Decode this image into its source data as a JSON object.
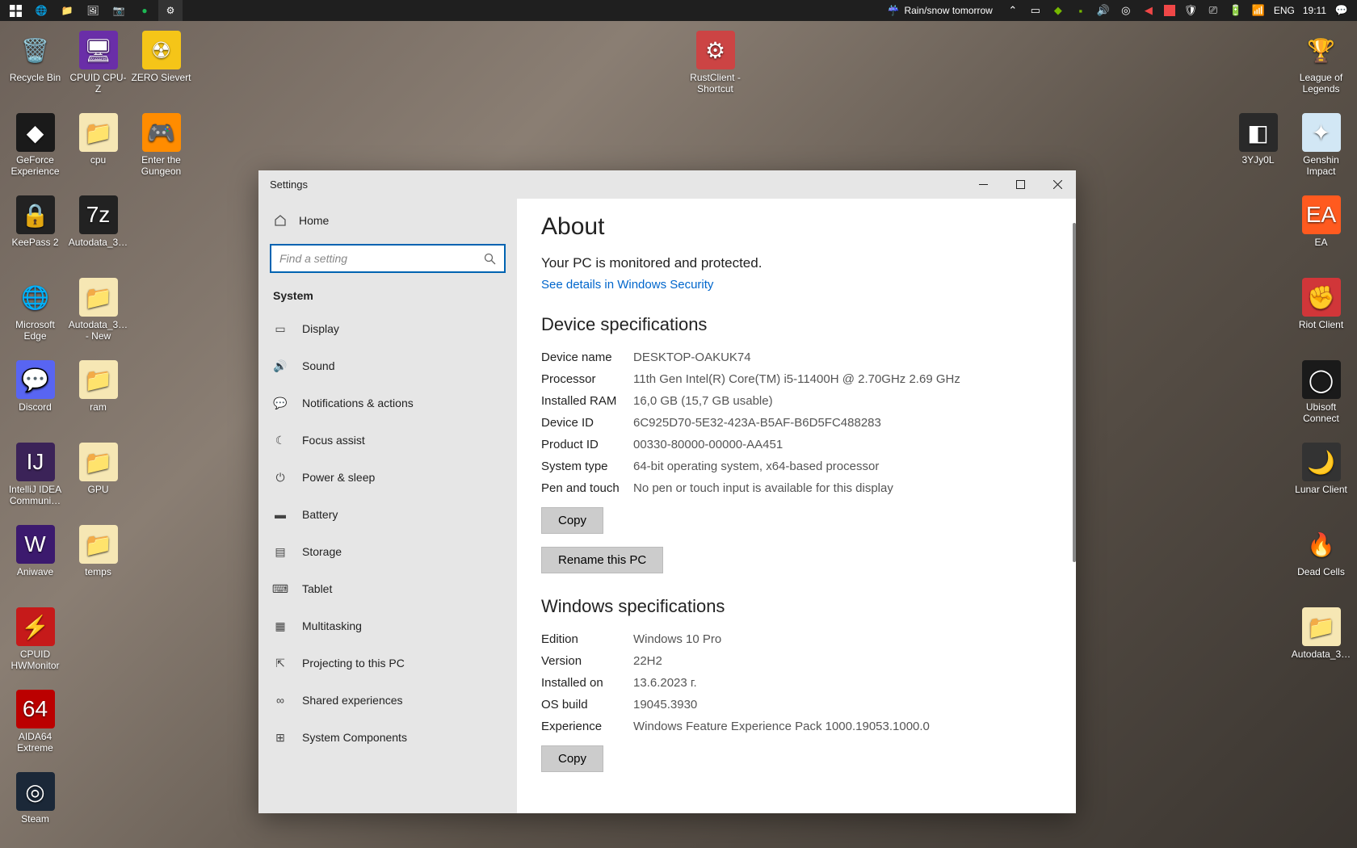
{
  "taskbar": {
    "weather_text": "Rain/snow tomorrow",
    "lang": "ENG",
    "time": "19:11"
  },
  "desktop_icons": {
    "left": [
      {
        "label": "Recycle Bin",
        "bg": "",
        "glyph": "🗑️"
      },
      {
        "label": "CPUID CPU-Z",
        "bg": "#6a2ea8",
        "glyph": "🖥"
      },
      {
        "label": "ZERO Sievert",
        "bg": "#f5c518",
        "glyph": "☢"
      },
      {
        "label": "GeForce Experience",
        "bg": "#1a1a1a",
        "glyph": "◆"
      },
      {
        "label": "cpu",
        "bg": "#f6e7b4",
        "glyph": "📁"
      },
      {
        "label": "Enter the Gungeon",
        "bg": "#ff8c00",
        "glyph": "🎮"
      },
      {
        "label": "KeePass 2",
        "bg": "#222",
        "glyph": "🔒"
      },
      {
        "label": "Autodata_3…",
        "bg": "#222",
        "glyph": "7z"
      },
      {
        "label": "Microsoft Edge",
        "bg": "",
        "glyph": "🌐"
      },
      {
        "label": "Autodata_3… - New",
        "bg": "#f6e7b4",
        "glyph": "📁"
      },
      {
        "label": "Discord",
        "bg": "#5865F2",
        "glyph": "💬"
      },
      {
        "label": "ram",
        "bg": "#f6e7b4",
        "glyph": "📁"
      },
      {
        "label": "IntelliJ IDEA Communi…",
        "bg": "#3b2358",
        "glyph": "IJ"
      },
      {
        "label": "GPU",
        "bg": "#f6e7b4",
        "glyph": "📁"
      },
      {
        "label": "Aniwave",
        "bg": "#3c1a6e",
        "glyph": "W"
      },
      {
        "label": "temps",
        "bg": "#f6e7b4",
        "glyph": "📁"
      },
      {
        "label": "CPUID HWMonitor",
        "bg": "#c61a1a",
        "glyph": "⚡"
      },
      {
        "label": "AIDA64 Extreme",
        "bg": "#b00",
        "glyph": "64"
      },
      {
        "label": "Steam",
        "bg": "#1b2838",
        "glyph": "◎"
      }
    ],
    "center": {
      "label": "RustClient - Shortcut",
      "bg": "#c44",
      "glyph": "⚙"
    },
    "right": [
      {
        "label": "League of Legends",
        "bg": "",
        "glyph": "🏆"
      },
      {
        "label": "3YJy0L",
        "bg": "#2a2a2a",
        "glyph": "◧"
      },
      {
        "label": "Genshin Impact",
        "bg": "#d2e7f5",
        "glyph": "✦"
      },
      {
        "label": "EA",
        "bg": "#ff5a1f",
        "glyph": "EA"
      },
      {
        "label": "Riot Client",
        "bg": "#d13639",
        "glyph": "✊"
      },
      {
        "label": "Ubisoft Connect",
        "bg": "#1a1a1a",
        "glyph": "◯"
      },
      {
        "label": "Lunar Client",
        "bg": "#333",
        "glyph": "🌙"
      },
      {
        "label": "Dead Cells",
        "bg": "",
        "glyph": "🔥"
      },
      {
        "label": "Autodata_3…",
        "bg": "#f6e7b4",
        "glyph": "📁"
      }
    ]
  },
  "settings": {
    "title": "Settings",
    "home": "Home",
    "search_placeholder": "Find a setting",
    "section": "System",
    "nav": [
      {
        "label": "Display"
      },
      {
        "label": "Sound"
      },
      {
        "label": "Notifications & actions"
      },
      {
        "label": "Focus assist"
      },
      {
        "label": "Power & sleep"
      },
      {
        "label": "Battery"
      },
      {
        "label": "Storage"
      },
      {
        "label": "Tablet"
      },
      {
        "label": "Multitasking"
      },
      {
        "label": "Projecting to this PC"
      },
      {
        "label": "Shared experiences"
      },
      {
        "label": "System Components"
      }
    ],
    "page_title": "About",
    "protection_heading": "Your PC is monitored and protected.",
    "security_link": "See details in Windows Security",
    "device_heading": "Device specifications",
    "device": {
      "name_k": "Device name",
      "name_v": "DESKTOP-OAKUK74",
      "proc_k": "Processor",
      "proc_v": "11th Gen Intel(R) Core(TM) i5-11400H @ 2.70GHz 2.69 GHz",
      "ram_k": "Installed RAM",
      "ram_v": "16,0 GB (15,7 GB usable)",
      "devid_k": "Device ID",
      "devid_v": "6C925D70-5E32-423A-B5AF-B6D5FC488283",
      "prodid_k": "Product ID",
      "prodid_v": "00330-80000-00000-AA451",
      "systype_k": "System type",
      "systype_v": "64-bit operating system, x64-based processor",
      "pen_k": "Pen and touch",
      "pen_v": "No pen or touch input is available for this display"
    },
    "copy_btn": "Copy",
    "rename_btn": "Rename this PC",
    "windows_heading": "Windows specifications",
    "windows": {
      "edition_k": "Edition",
      "edition_v": "Windows 10 Pro",
      "version_k": "Version",
      "version_v": "22H2",
      "installed_k": "Installed on",
      "installed_v": "13.6.2023 г.",
      "build_k": "OS build",
      "build_v": "19045.3930",
      "exp_k": "Experience",
      "exp_v": "Windows Feature Experience Pack 1000.19053.1000.0"
    }
  }
}
